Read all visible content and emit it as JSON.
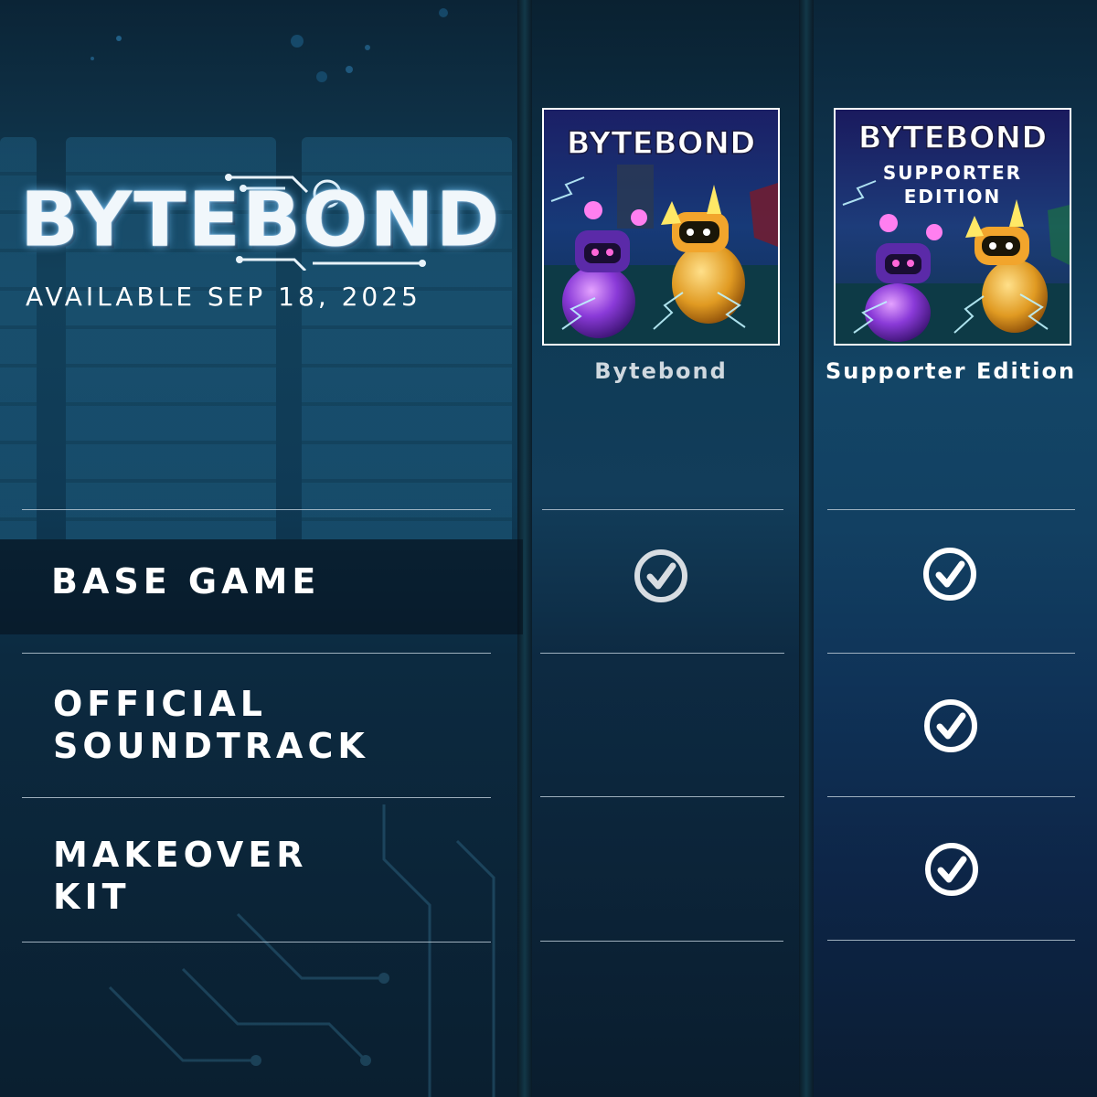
{
  "header": {
    "logo_text": "BYTEBOND",
    "release_text": "AVAILABLE SEP 18, 2025"
  },
  "editions": [
    {
      "name": "Bytebond",
      "cover": {
        "logo": "BYTEBOND",
        "subtitle_lines": []
      },
      "name_color": "#cfd8df"
    },
    {
      "name": "Supporter Edition",
      "cover": {
        "logo": "BYTEBOND",
        "subtitle_lines": [
          "SUPPORTER",
          "EDITION"
        ]
      },
      "name_color": "#ffffff"
    }
  ],
  "features": [
    {
      "label_lines": [
        "BASE GAME"
      ],
      "included": [
        true,
        true
      ]
    },
    {
      "label_lines": [
        "OFFICIAL",
        "SOUNDTRACK"
      ],
      "included": [
        false,
        true
      ]
    },
    {
      "label_lines": [
        "MAKEOVER",
        "KIT"
      ],
      "included": [
        false,
        true
      ]
    }
  ],
  "icons": {
    "included": "check-circle-icon"
  },
  "colors": {
    "check_bytebond": "#d8dde2",
    "check_supporter": "#ffffff",
    "logo_glow": "#78c8ff",
    "background": "#0c2233"
  }
}
